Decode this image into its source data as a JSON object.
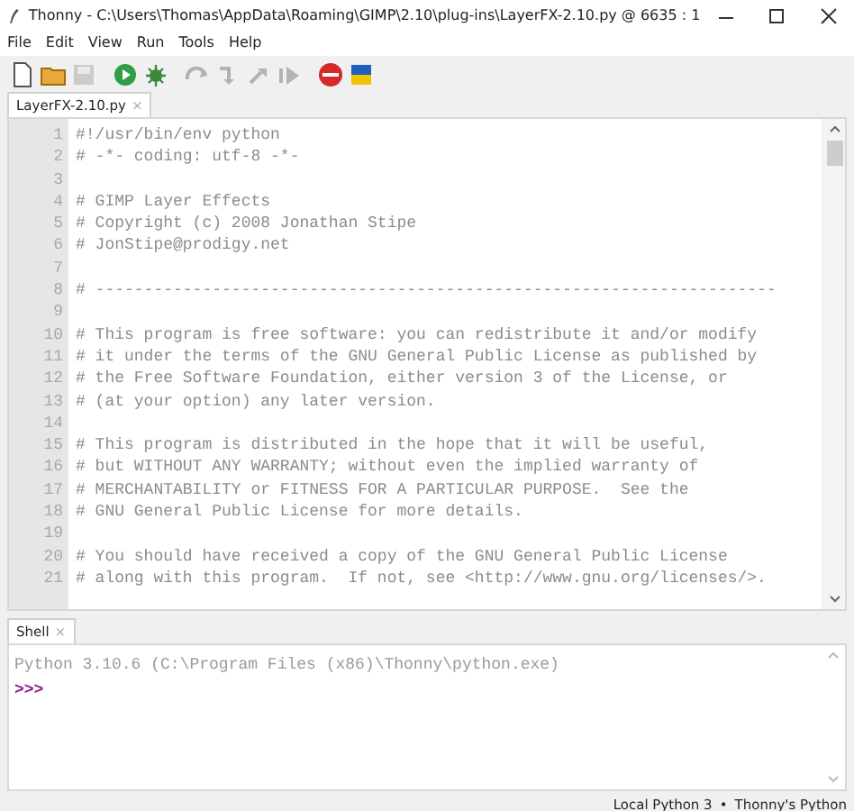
{
  "window": {
    "title": "Thonny  -  C:\\Users\\Thomas\\AppData\\Roaming\\GIMP\\2.10\\plug-ins\\LayerFX-2.10.py  @  6635 : 1"
  },
  "menu": [
    "File",
    "Edit",
    "View",
    "Run",
    "Tools",
    "Help"
  ],
  "toolbar": [
    {
      "kind": "new",
      "disabled": false
    },
    {
      "kind": "open",
      "disabled": false
    },
    {
      "kind": "save",
      "disabled": true
    },
    {
      "kind": "run",
      "disabled": false
    },
    {
      "kind": "debug",
      "disabled": false
    },
    {
      "kind": "step-over",
      "disabled": true
    },
    {
      "kind": "step-into",
      "disabled": true
    },
    {
      "kind": "step-out",
      "disabled": true
    },
    {
      "kind": "resume",
      "disabled": true
    },
    {
      "kind": "stop",
      "disabled": false
    },
    {
      "kind": "flag",
      "disabled": false
    }
  ],
  "editor_tabs": [
    {
      "label": "LayerFX-2.10.py",
      "close": "×",
      "selected": true
    }
  ],
  "editor_lines": [
    {
      "number": "1",
      "text": "#!/usr/bin/env python"
    },
    {
      "number": "2",
      "text": "# -*- coding: utf-8 -*-"
    },
    {
      "number": "3"
    },
    {
      "number": "4",
      "text": "# GIMP Layer Effects"
    },
    {
      "number": "5",
      "text": "# Copyright (c) 2008 Jonathan Stipe"
    },
    {
      "number": "6",
      "text": "# JonStipe@prodigy.net"
    },
    {
      "number": "7"
    },
    {
      "number": "8",
      "text": "# ----------------------------------------------------------------------"
    },
    {
      "number": "9"
    },
    {
      "number": "10",
      "text": "# This program is free software: you can redistribute it and/or modify"
    },
    {
      "number": "11",
      "text": "# it under the terms of the GNU General Public License as published by"
    },
    {
      "number": "12",
      "text": "# the Free Software Foundation, either version 3 of the License, or"
    },
    {
      "number": "13",
      "text": "# (at your option) any later version."
    },
    {
      "number": "14"
    },
    {
      "number": "15",
      "text": "# This program is distributed in the hope that it will be useful,"
    },
    {
      "number": "16",
      "text": "# but WITHOUT ANY WARRANTY; without even the implied warranty of"
    },
    {
      "number": "17",
      "text": "# MERCHANTABILITY or FITNESS FOR A PARTICULAR PURPOSE.  See the"
    },
    {
      "number": "18",
      "text": "# GNU General Public License for more details."
    },
    {
      "number": "19"
    },
    {
      "number": "20",
      "text": "# You should have received a copy of the GNU General Public License"
    },
    {
      "number": "21",
      "text": "# along with this program.  If not, see <http://www.gnu.org/licenses/>."
    }
  ],
  "shell_tabs": [
    {
      "label": "Shell",
      "close": "×",
      "selected": true
    }
  ],
  "shell_lines": [
    {
      "kind": "banner",
      "text": "Python 3.10.6 (C:\\Program Files (x86)\\Thonny\\python.exe)"
    },
    {
      "kind": "prompt",
      "text": ">>>"
    }
  ],
  "status_bar": {
    "interpreter": "Local Python 3",
    "separator": "•",
    "environment": "Thonny's Python"
  }
}
